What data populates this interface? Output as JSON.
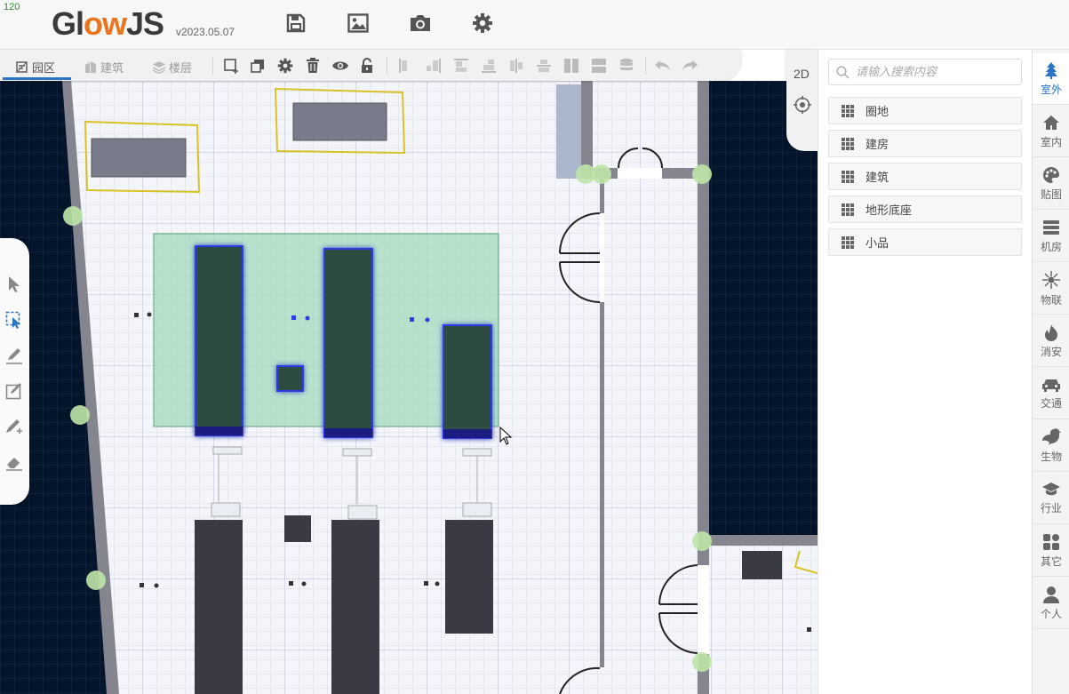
{
  "header": {
    "fps": "120",
    "logo_part1": "Gl",
    "logo_part2": "ow",
    "logo_part3": "JS",
    "version": "v2023.05.07"
  },
  "toolbar": {
    "tabs": [
      {
        "label": "园区",
        "active": true
      },
      {
        "label": "建筑",
        "active": false
      },
      {
        "label": "楼层",
        "active": false
      }
    ]
  },
  "view_panel": {
    "mode_label": "2D"
  },
  "right_panel": {
    "search_placeholder": "请输入搜索内容",
    "categories": [
      "圈地",
      "建房",
      "建筑",
      "地形底座",
      "小品"
    ]
  },
  "side_tabs": [
    {
      "label": "室外",
      "icon": "tree-icon",
      "active": true
    },
    {
      "label": "室内",
      "icon": "home-icon",
      "active": false
    },
    {
      "label": "贴图",
      "icon": "palette-icon",
      "active": false
    },
    {
      "label": "机房",
      "icon": "server-icon",
      "active": false
    },
    {
      "label": "物联",
      "icon": "iot-icon",
      "active": false
    },
    {
      "label": "消安",
      "icon": "fire-icon",
      "active": false
    },
    {
      "label": "交通",
      "icon": "car-icon",
      "active": false
    },
    {
      "label": "生物",
      "icon": "bird-icon",
      "active": false
    },
    {
      "label": "行业",
      "icon": "graduation-cap-icon",
      "active": false
    },
    {
      "label": "其它",
      "icon": "shapes-icon",
      "active": false
    },
    {
      "label": "个人",
      "icon": "user-icon",
      "active": false
    }
  ],
  "colors": {
    "accent": "#2b73c6",
    "logo_orange": "#e9761f",
    "selection_fill": "#9ed8b8",
    "wall": "#858590",
    "outside": "#04142a"
  }
}
